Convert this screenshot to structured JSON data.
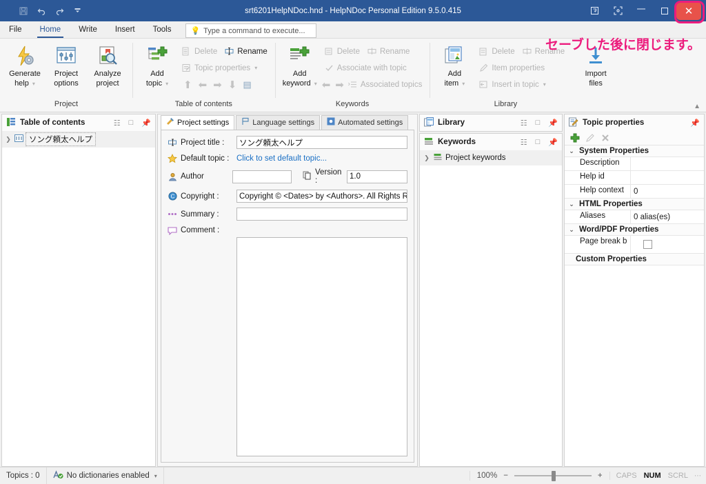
{
  "titlebar": {
    "document_title": "srt6201HelpNDoc.hnd - HelpNDoc Personal Edition 9.5.0.415",
    "qat": [
      {
        "name": "save",
        "glyph": "ὋE"
      },
      {
        "name": "undo",
        "glyph": "↶"
      },
      {
        "name": "redo",
        "glyph": "↷"
      },
      {
        "name": "customize",
        "glyph": "▼"
      }
    ],
    "window_buttons": {
      "restore_ribbon": "⧉",
      "fullscreen": "❐",
      "minimize": "—",
      "maximize": "□",
      "close": "✕"
    }
  },
  "annotation": {
    "text": "セーブした後に閉じます。",
    "color": "#ec1c7d"
  },
  "ribbon_tabs": {
    "items": [
      {
        "label": "File",
        "active": false
      },
      {
        "label": "Home",
        "active": true
      },
      {
        "label": "Write",
        "active": false
      },
      {
        "label": "Insert",
        "active": false
      },
      {
        "label": "Tools",
        "active": false
      }
    ],
    "command_box_placeholder": "Type a command to execute..."
  },
  "ribbon": {
    "groups": [
      {
        "title": "Project",
        "big_buttons": [
          {
            "label_line1": "Generate",
            "label_line2": "help",
            "icon": "lightning-gear-icon",
            "dropdown": true
          },
          {
            "label_line1": "Project",
            "label_line2": "options",
            "icon": "sliders-icon",
            "dropdown": false
          },
          {
            "label_line1": "Analyze",
            "label_line2": "project",
            "icon": "document-magnifier-icon",
            "dropdown": false
          }
        ],
        "small_buttons": []
      },
      {
        "title": "Table of contents",
        "big_buttons": [
          {
            "label_line1": "Add",
            "label_line2": "topic",
            "icon": "add-topic-icon",
            "dropdown": true
          }
        ],
        "small_buttons": [
          {
            "label": "Delete",
            "icon": "delete-icon",
            "enabled": false,
            "dropdown": false
          },
          {
            "label": "Rename",
            "icon": "rename-icon",
            "enabled": false,
            "dropdown": false
          },
          {
            "label": "Topic properties",
            "icon": "topic-properties-icon",
            "enabled": false,
            "dropdown": true
          }
        ],
        "arrows": [
          "⬆",
          "⬅",
          "➡",
          "⬇",
          "☰"
        ]
      },
      {
        "title": "Keywords",
        "big_buttons": [
          {
            "label_line1": "Add",
            "label_line2": "keyword",
            "icon": "add-keyword-icon",
            "dropdown": true
          }
        ],
        "small_buttons": [
          {
            "label": "Delete",
            "icon": "delete-icon",
            "enabled": false,
            "dropdown": false
          },
          {
            "label": "Rename",
            "icon": "rename-icon",
            "enabled": false,
            "dropdown": false
          },
          {
            "label": "Associate with topic",
            "icon": "check-icon",
            "enabled": false,
            "dropdown": false
          },
          {
            "label": "Associated topics",
            "icon": "associated-topics-icon",
            "enabled": false,
            "dropdown": false
          }
        ],
        "arrows": [
          "⬅",
          "➡"
        ]
      },
      {
        "title": "Library",
        "big_buttons": [
          {
            "label_line1": "Add",
            "label_line2": "item",
            "icon": "add-item-icon",
            "dropdown": true
          },
          {
            "label_line1": "Import",
            "label_line2": "files",
            "icon": "import-files-icon",
            "dropdown": false
          }
        ],
        "small_buttons": [
          {
            "label": "Delete",
            "icon": "delete-icon",
            "enabled": false,
            "dropdown": false
          },
          {
            "label": "Rename",
            "icon": "rename-icon",
            "enabled": false,
            "dropdown": false
          },
          {
            "label": "Item properties",
            "icon": "pencil-icon",
            "enabled": false,
            "dropdown": false
          },
          {
            "label": "Insert in topic",
            "icon": "insert-in-topic-icon",
            "enabled": false,
            "dropdown": true
          }
        ]
      }
    ],
    "collapse_icon": "chevron-up-icon"
  },
  "toc_panel": {
    "title": "Table of contents",
    "icon": "toc-icon",
    "header_icons": [
      "restore-icon",
      "maximize-icon",
      "pin-icon"
    ],
    "tree": [
      {
        "label": "ソング頼太ヘルプ",
        "expander": "❯",
        "selected": true
      }
    ]
  },
  "center_panel": {
    "tabs": [
      {
        "label": "Project settings",
        "icon": "project-settings-icon",
        "active": true
      },
      {
        "label": "Language settings",
        "icon": "language-settings-icon",
        "active": false
      },
      {
        "label": "Automated settings",
        "icon": "automated-settings-icon",
        "active": false
      }
    ],
    "fields": {
      "project_title_label": "Project title :",
      "project_title_value": "ソング頼太ヘルプ",
      "default_topic_label": "Default topic :",
      "default_topic_link": "Click to set default topic...",
      "author_label": "Author",
      "author_value": "",
      "version_label": "Version :",
      "version_value": "1.0",
      "copyright_label": "Copyright :",
      "copyright_value": "Copyright © <Dates> by <Authors>. All Rights Reserved.",
      "summary_label": "Summary :",
      "summary_value": "",
      "comment_label": "Comment :",
      "comment_value": ""
    }
  },
  "library_panel": {
    "title": "Library",
    "icon": "library-icon",
    "header_icons": [
      "restore-icon",
      "maximize-icon",
      "pin-icon"
    ]
  },
  "keywords_panel": {
    "title": "Keywords",
    "icon": "keywords-icon",
    "header_icons": [
      "restore-icon",
      "maximize-icon",
      "pin-icon"
    ],
    "tree": [
      {
        "label": "Project keywords",
        "expander": "❯"
      }
    ]
  },
  "properties_panel": {
    "title": "Topic properties",
    "icon": "topic-properties-icon",
    "header_icons": [
      "pin-icon"
    ],
    "toolbar": [
      {
        "name": "add-property-button",
        "glyph": "✚",
        "enabled": true
      },
      {
        "name": "edit-property-button",
        "glyph": "✎",
        "enabled": false
      },
      {
        "name": "delete-property-button",
        "glyph": "✕",
        "enabled": false
      }
    ],
    "groups": [
      {
        "title": "System Properties",
        "collapsible": true,
        "rows": [
          {
            "name": "Description",
            "value": ""
          },
          {
            "name": "Help id",
            "value": ""
          },
          {
            "name": "Help context",
            "value": "0"
          }
        ]
      },
      {
        "title": "HTML Properties",
        "collapsible": true,
        "rows": [
          {
            "name": "Aliases",
            "value": "0 alias(es)"
          }
        ]
      },
      {
        "title": "Word/PDF Properties",
        "collapsible": true,
        "rows": [
          {
            "name": "Page break b",
            "value": "",
            "checkbox": true
          }
        ]
      },
      {
        "title": "Custom Properties",
        "collapsible": false,
        "rows": []
      }
    ]
  },
  "statusbar": {
    "topics_label": "Topics : 0",
    "dictionary_label": "No dictionaries enabled",
    "dictionary_icon": "spellcheck-icon",
    "dictionary_caret": "⌄",
    "zoom_level": "100%",
    "zoom_minus": "−",
    "zoom_plus": "+",
    "flags": [
      {
        "label": "CAPS",
        "active": false
      },
      {
        "label": "NUM",
        "active": true
      },
      {
        "label": "SCRL",
        "active": false
      }
    ]
  }
}
